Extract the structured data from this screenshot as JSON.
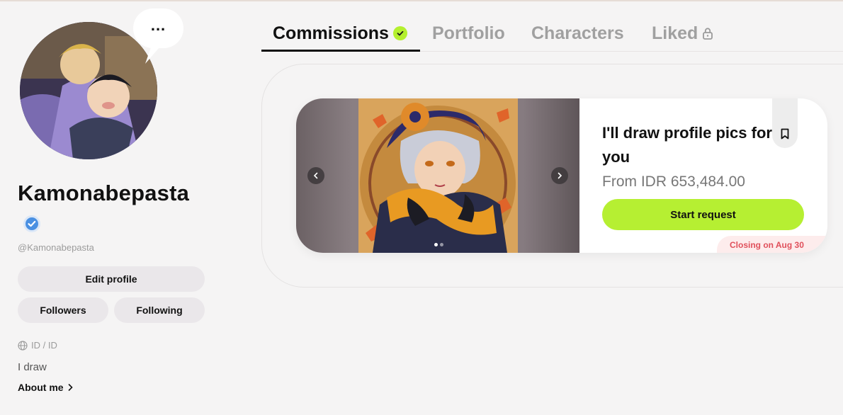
{
  "profile": {
    "more_menu": "...",
    "username": "Kamonabepasta",
    "handle": "@Kamonabepasta",
    "edit_profile": "Edit profile",
    "followers": "Followers",
    "following": "Following",
    "locale": "ID / ID",
    "bio": "I draw",
    "about": "About me"
  },
  "tabs": [
    {
      "label": "Commissions",
      "active": true,
      "icon": "check-badge-icon"
    },
    {
      "label": "Portfolio",
      "active": false
    },
    {
      "label": "Characters",
      "active": false
    },
    {
      "label": "Liked",
      "active": false,
      "icon": "lock-icon"
    }
  ],
  "commission": {
    "title": "I'll draw profile pics for you",
    "price": "From IDR 653,484.00",
    "cta": "Start request",
    "closing": "Closing on Aug 30"
  },
  "colors": {
    "accent": "#b6ef32",
    "verified": "#4a90e2",
    "closing": "#e0505b"
  }
}
